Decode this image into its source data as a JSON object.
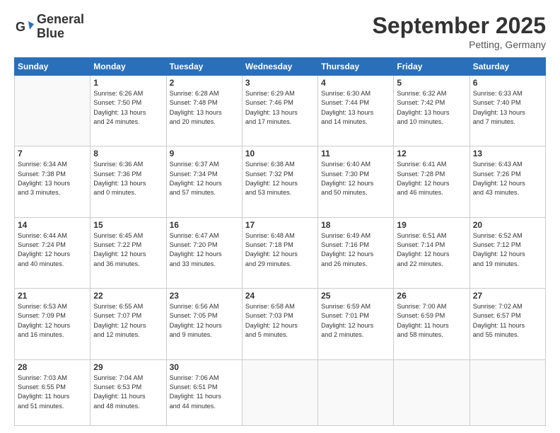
{
  "header": {
    "logo_general": "General",
    "logo_blue": "Blue",
    "month_title": "September 2025",
    "location": "Petting, Germany"
  },
  "weekdays": [
    "Sunday",
    "Monday",
    "Tuesday",
    "Wednesday",
    "Thursday",
    "Friday",
    "Saturday"
  ],
  "weeks": [
    [
      {
        "day": "",
        "info": ""
      },
      {
        "day": "1",
        "info": "Sunrise: 6:26 AM\nSunset: 7:50 PM\nDaylight: 13 hours\nand 24 minutes."
      },
      {
        "day": "2",
        "info": "Sunrise: 6:28 AM\nSunset: 7:48 PM\nDaylight: 13 hours\nand 20 minutes."
      },
      {
        "day": "3",
        "info": "Sunrise: 6:29 AM\nSunset: 7:46 PM\nDaylight: 13 hours\nand 17 minutes."
      },
      {
        "day": "4",
        "info": "Sunrise: 6:30 AM\nSunset: 7:44 PM\nDaylight: 13 hours\nand 14 minutes."
      },
      {
        "day": "5",
        "info": "Sunrise: 6:32 AM\nSunset: 7:42 PM\nDaylight: 13 hours\nand 10 minutes."
      },
      {
        "day": "6",
        "info": "Sunrise: 6:33 AM\nSunset: 7:40 PM\nDaylight: 13 hours\nand 7 minutes."
      }
    ],
    [
      {
        "day": "7",
        "info": "Sunrise: 6:34 AM\nSunset: 7:38 PM\nDaylight: 13 hours\nand 3 minutes."
      },
      {
        "day": "8",
        "info": "Sunrise: 6:36 AM\nSunset: 7:36 PM\nDaylight: 13 hours\nand 0 minutes."
      },
      {
        "day": "9",
        "info": "Sunrise: 6:37 AM\nSunset: 7:34 PM\nDaylight: 12 hours\nand 57 minutes."
      },
      {
        "day": "10",
        "info": "Sunrise: 6:38 AM\nSunset: 7:32 PM\nDaylight: 12 hours\nand 53 minutes."
      },
      {
        "day": "11",
        "info": "Sunrise: 6:40 AM\nSunset: 7:30 PM\nDaylight: 12 hours\nand 50 minutes."
      },
      {
        "day": "12",
        "info": "Sunrise: 6:41 AM\nSunset: 7:28 PM\nDaylight: 12 hours\nand 46 minutes."
      },
      {
        "day": "13",
        "info": "Sunrise: 6:43 AM\nSunset: 7:26 PM\nDaylight: 12 hours\nand 43 minutes."
      }
    ],
    [
      {
        "day": "14",
        "info": "Sunrise: 6:44 AM\nSunset: 7:24 PM\nDaylight: 12 hours\nand 40 minutes."
      },
      {
        "day": "15",
        "info": "Sunrise: 6:45 AM\nSunset: 7:22 PM\nDaylight: 12 hours\nand 36 minutes."
      },
      {
        "day": "16",
        "info": "Sunrise: 6:47 AM\nSunset: 7:20 PM\nDaylight: 12 hours\nand 33 minutes."
      },
      {
        "day": "17",
        "info": "Sunrise: 6:48 AM\nSunset: 7:18 PM\nDaylight: 12 hours\nand 29 minutes."
      },
      {
        "day": "18",
        "info": "Sunrise: 6:49 AM\nSunset: 7:16 PM\nDaylight: 12 hours\nand 26 minutes."
      },
      {
        "day": "19",
        "info": "Sunrise: 6:51 AM\nSunset: 7:14 PM\nDaylight: 12 hours\nand 22 minutes."
      },
      {
        "day": "20",
        "info": "Sunrise: 6:52 AM\nSunset: 7:12 PM\nDaylight: 12 hours\nand 19 minutes."
      }
    ],
    [
      {
        "day": "21",
        "info": "Sunrise: 6:53 AM\nSunset: 7:09 PM\nDaylight: 12 hours\nand 16 minutes."
      },
      {
        "day": "22",
        "info": "Sunrise: 6:55 AM\nSunset: 7:07 PM\nDaylight: 12 hours\nand 12 minutes."
      },
      {
        "day": "23",
        "info": "Sunrise: 6:56 AM\nSunset: 7:05 PM\nDaylight: 12 hours\nand 9 minutes."
      },
      {
        "day": "24",
        "info": "Sunrise: 6:58 AM\nSunset: 7:03 PM\nDaylight: 12 hours\nand 5 minutes."
      },
      {
        "day": "25",
        "info": "Sunrise: 6:59 AM\nSunset: 7:01 PM\nDaylight: 12 hours\nand 2 minutes."
      },
      {
        "day": "26",
        "info": "Sunrise: 7:00 AM\nSunset: 6:59 PM\nDaylight: 11 hours\nand 58 minutes."
      },
      {
        "day": "27",
        "info": "Sunrise: 7:02 AM\nSunset: 6:57 PM\nDaylight: 11 hours\nand 55 minutes."
      }
    ],
    [
      {
        "day": "28",
        "info": "Sunrise: 7:03 AM\nSunset: 6:55 PM\nDaylight: 11 hours\nand 51 minutes."
      },
      {
        "day": "29",
        "info": "Sunrise: 7:04 AM\nSunset: 6:53 PM\nDaylight: 11 hours\nand 48 minutes."
      },
      {
        "day": "30",
        "info": "Sunrise: 7:06 AM\nSunset: 6:51 PM\nDaylight: 11 hours\nand 44 minutes."
      },
      {
        "day": "",
        "info": ""
      },
      {
        "day": "",
        "info": ""
      },
      {
        "day": "",
        "info": ""
      },
      {
        "day": "",
        "info": ""
      }
    ]
  ]
}
